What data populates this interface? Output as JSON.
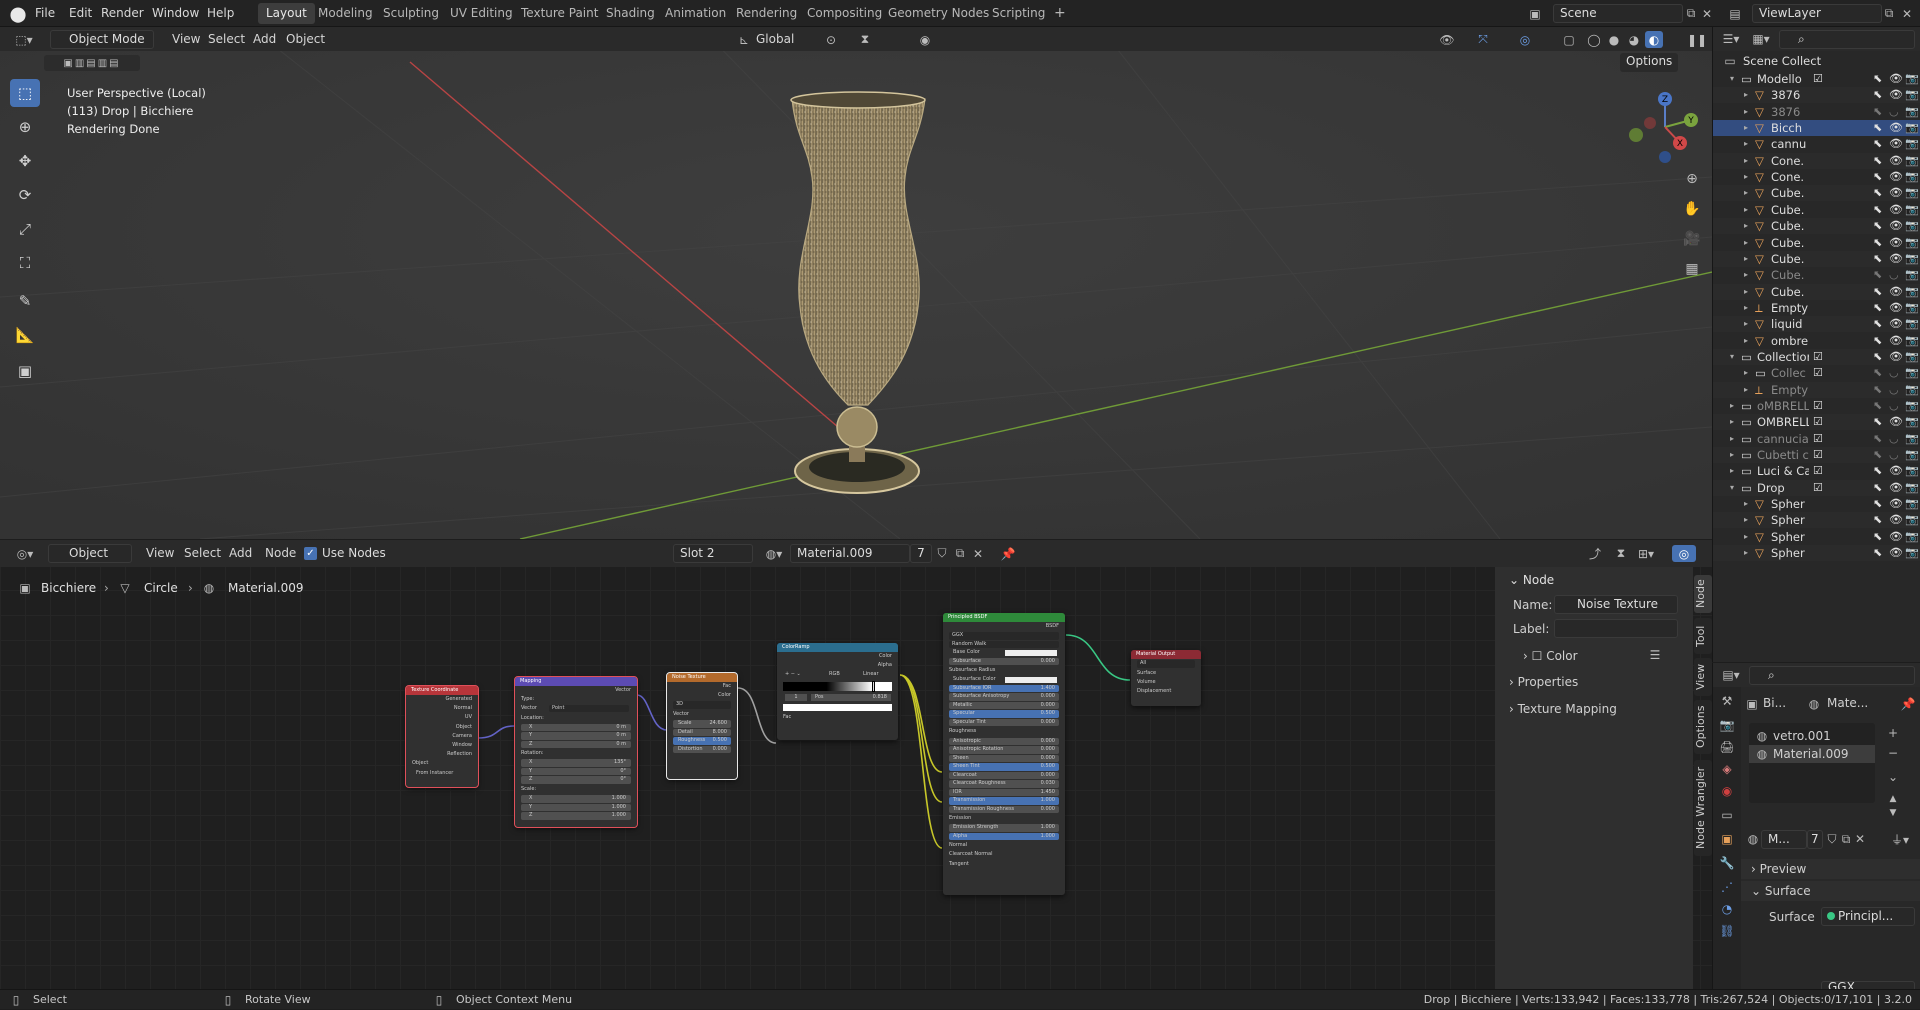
{
  "topbar": {
    "menus": [
      "File",
      "Edit",
      "Render",
      "Window",
      "Help"
    ],
    "workspaces": [
      "Layout",
      "Modeling",
      "Sculpting",
      "UV Editing",
      "Texture Paint",
      "Shading",
      "Animation",
      "Rendering",
      "Compositing",
      "Geometry Nodes",
      "Scripting"
    ],
    "add_ws": "+",
    "scene": "Scene",
    "view_layer": "ViewLayer"
  },
  "viewport": {
    "mode": "Object Mode",
    "menus": [
      "View",
      "Select",
      "Add",
      "Object"
    ],
    "orientation": "Global",
    "options": "Options",
    "info_line1": "User Perspective (Local)",
    "info_line2": "(113) Drop | Bicchiere",
    "info_line3": "Rendering Done",
    "gizmo": {
      "z": "Z",
      "y": "Y",
      "x": "X"
    }
  },
  "node_editor": {
    "mode": "Object",
    "menus": [
      "View",
      "Select",
      "Add",
      "Node"
    ],
    "use_nodes": "Use Nodes",
    "slot": "Slot 2",
    "material": "Material.009",
    "users": "7",
    "breadcrumb": [
      "Bicchiere",
      "Circle",
      "Material.009"
    ],
    "nodes": {
      "texcoord": {
        "title": "Texture Coordinate",
        "outputs": [
          "Generated",
          "Normal",
          "UV",
          "Object",
          "Camera",
          "Window",
          "Reflection"
        ],
        "object_label": "Object",
        "from_instancer": "From Instancer"
      },
      "mapping": {
        "title": "Mapping",
        "out": "Vector",
        "type_label": "Type:",
        "type_value": "Point",
        "vector": "Vector",
        "location": "Location:",
        "loc": [
          [
            "X",
            "0 m"
          ],
          [
            "Y",
            "0 m"
          ],
          [
            "Z",
            "0 m"
          ]
        ],
        "rotation": "Rotation:",
        "rot": [
          [
            "X",
            "135°"
          ],
          [
            "Y",
            "0°"
          ],
          [
            "Z",
            "0°"
          ]
        ],
        "scale": "Scale:",
        "scl": [
          [
            "X",
            "1.000"
          ],
          [
            "Y",
            "1.000"
          ],
          [
            "Z",
            "1.000"
          ]
        ]
      },
      "noise": {
        "title": "Noise Texture",
        "outs": [
          "Fac",
          "Color"
        ],
        "dim": "3D",
        "vector": "Vector",
        "fields": [
          [
            "Scale",
            "24.600"
          ],
          [
            "Detail",
            "8.000"
          ],
          [
            "Roughness",
            "0.500"
          ],
          [
            "Distortion",
            "0.000"
          ]
        ]
      },
      "ramp": {
        "title": "ColorRamp",
        "outs": [
          "Color",
          "Alpha"
        ],
        "mode": "RGB",
        "interp": "Linear",
        "pos_label": "Pos",
        "pos_value": "0.818",
        "index": "1",
        "fac": "Fac"
      },
      "bsdf": {
        "title": "Principled BSDF",
        "out": "BSDF",
        "dist": "GGX",
        "sss": "Random Walk",
        "rows": [
          [
            "Base Color",
            ""
          ],
          [
            "Subsurface",
            "0.000"
          ],
          [
            "Subsurface Radius",
            ""
          ],
          [
            "Subsurface Color",
            ""
          ],
          [
            "Subsurface IOR",
            "1.400"
          ],
          [
            "Subsurface Anisotropy",
            "0.000"
          ],
          [
            "Metallic",
            "0.000"
          ],
          [
            "Specular",
            "0.500"
          ],
          [
            "Specular Tint",
            "0.000"
          ],
          [
            "Roughness",
            ""
          ],
          [
            "Anisotropic",
            "0.000"
          ],
          [
            "Anisotropic Rotation",
            "0.000"
          ],
          [
            "Sheen",
            "0.000"
          ],
          [
            "Sheen Tint",
            "0.500"
          ],
          [
            "Clearcoat",
            "0.000"
          ],
          [
            "Clearcoat Roughness",
            "0.030"
          ],
          [
            "IOR",
            "1.450"
          ],
          [
            "Transmission",
            "1.000"
          ],
          [
            "Transmission Roughness",
            "0.000"
          ],
          [
            "Emission",
            ""
          ],
          [
            "Emission Strength",
            "1.000"
          ],
          [
            "Alpha",
            "1.000"
          ],
          [
            "Normal",
            ""
          ],
          [
            "Clearcoat Normal",
            ""
          ],
          [
            "Tangent",
            ""
          ]
        ]
      },
      "output": {
        "title": "Material Output",
        "target": "All",
        "inputs": [
          "Surface",
          "Volume",
          "Displacement"
        ]
      }
    }
  },
  "npanel": {
    "section": "Node",
    "name_label": "Name:",
    "name_value": "Noise Texture",
    "label_label": "Label:",
    "label_value": "",
    "color": "Color",
    "properties": "Properties",
    "texture_mapping": "Texture Mapping",
    "tabs": [
      "Node",
      "Tool",
      "View",
      "Options",
      "Node Wrangler"
    ]
  },
  "outliner": {
    "root": "Scene Collect",
    "rows": [
      {
        "name": "Modello",
        "kind": "coll",
        "indent": 1,
        "open": true
      },
      {
        "name": "3876",
        "kind": "mesh",
        "indent": 2
      },
      {
        "name": "3876",
        "kind": "mesh",
        "indent": 2,
        "dim": true
      },
      {
        "name": "Bicch",
        "kind": "mesh",
        "indent": 2,
        "sel": true
      },
      {
        "name": "cannu",
        "kind": "mesh",
        "indent": 2
      },
      {
        "name": "Cone.",
        "kind": "mesh",
        "indent": 2
      },
      {
        "name": "Cone.",
        "kind": "mesh",
        "indent": 2
      },
      {
        "name": "Cube.",
        "kind": "mesh",
        "indent": 2
      },
      {
        "name": "Cube.",
        "kind": "mesh",
        "indent": 2
      },
      {
        "name": "Cube.",
        "kind": "mesh",
        "indent": 2
      },
      {
        "name": "Cube.",
        "kind": "mesh",
        "indent": 2
      },
      {
        "name": "Cube.",
        "kind": "mesh",
        "indent": 2
      },
      {
        "name": "Cube.",
        "kind": "mesh",
        "indent": 2,
        "dim": true
      },
      {
        "name": "Cube.",
        "kind": "mesh",
        "indent": 2
      },
      {
        "name": "Empty",
        "kind": "empty",
        "indent": 2
      },
      {
        "name": "liquid",
        "kind": "mesh",
        "indent": 2
      },
      {
        "name": "ombre",
        "kind": "mesh",
        "indent": 2
      },
      {
        "name": "Collection",
        "kind": "coll",
        "indent": 1,
        "open": true
      },
      {
        "name": "Collec",
        "kind": "coll",
        "indent": 2,
        "dim": true
      },
      {
        "name": "Empty",
        "kind": "empty",
        "indent": 2,
        "dim": true
      },
      {
        "name": "oMBRELL",
        "kind": "coll",
        "indent": 1,
        "dim": true
      },
      {
        "name": "OMBRELL",
        "kind": "coll",
        "indent": 1
      },
      {
        "name": "cannucia",
        "kind": "coll",
        "indent": 1,
        "dim": true
      },
      {
        "name": "Cubetti cc",
        "kind": "coll",
        "indent": 1,
        "dim": true
      },
      {
        "name": "Luci & Ca",
        "kind": "coll",
        "indent": 1
      },
      {
        "name": "Drop",
        "kind": "coll",
        "indent": 1,
        "open": true
      },
      {
        "name": "Spher",
        "kind": "mesh",
        "indent": 2
      },
      {
        "name": "Spher",
        "kind": "mesh",
        "indent": 2
      },
      {
        "name": "Spher",
        "kind": "mesh",
        "indent": 2
      },
      {
        "name": "Spher",
        "kind": "mesh",
        "indent": 2
      }
    ]
  },
  "properties": {
    "obj_short": "Bi...",
    "mat_short": "Mate...",
    "slots": [
      "vetro.001",
      "Material.009"
    ],
    "mat_field": "M...",
    "users": "7",
    "preview": "Preview",
    "surface": "Surface",
    "surface_label": "Surface",
    "surface_value": "Principl...",
    "ggx": "GGX"
  },
  "status": {
    "select": "Select",
    "rotate": "Rotate View",
    "context": "Object Context Menu",
    "stats": "Drop | Bicchiere | Verts:133,942 | Faces:133,778 | Tris:267,524 | Objects:0/17,101 | 3.2.0"
  },
  "colors": {
    "accent": "#4772b3",
    "header": "#232323",
    "orange": "#e6a05a"
  }
}
